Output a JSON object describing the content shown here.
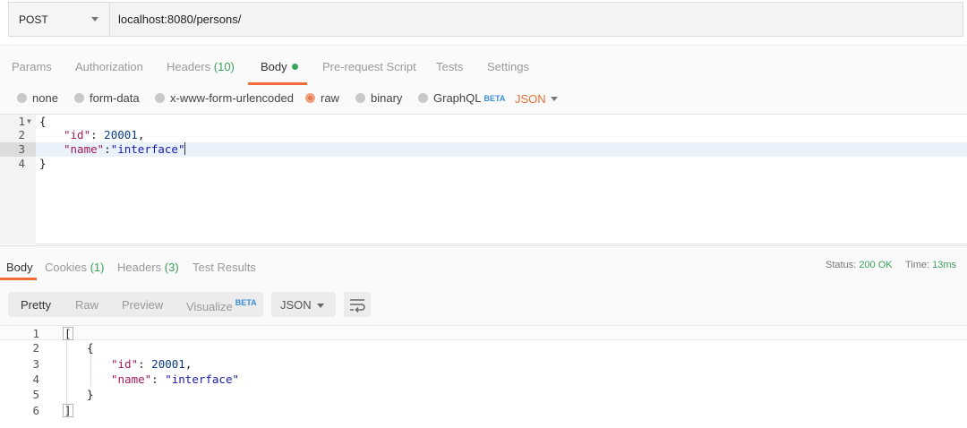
{
  "request": {
    "method": "POST",
    "url": "localhost:8080/persons/"
  },
  "request_tabs": {
    "params": "Params",
    "authorization": "Authorization",
    "headers": "Headers",
    "headers_count": "(10)",
    "body": "Body",
    "prerequest": "Pre-request Script",
    "tests": "Tests",
    "settings": "Settings"
  },
  "body_types": {
    "none": "none",
    "form_data": "form-data",
    "urlencoded": "x-www-form-urlencoded",
    "raw": "raw",
    "binary": "binary",
    "graphql": "GraphQL",
    "graphql_badge": "BETA",
    "selected": "raw",
    "format": "JSON"
  },
  "request_body": {
    "line_numbers": [
      "1",
      "2",
      "3",
      "4"
    ],
    "open_brace": "{",
    "id_key": "\"id\"",
    "id_value": "20001",
    "name_key": "\"name\"",
    "name_value": "\"interface\"",
    "close_brace": "}"
  },
  "response_tabs": {
    "body": "Body",
    "cookies": "Cookies",
    "cookies_count": "(1)",
    "headers": "Headers",
    "headers_count": "(3)",
    "test_results": "Test Results"
  },
  "response_status": {
    "status_label": "Status:",
    "status_value": "200 OK",
    "time_label": "Time:",
    "time_value": "13ms"
  },
  "response_view": {
    "pretty": "Pretty",
    "raw": "Raw",
    "preview": "Preview",
    "visualize": "Visualize",
    "visualize_badge": "BETA",
    "format": "JSON"
  },
  "response_body": {
    "line_numbers": [
      "1",
      "2",
      "3",
      "4",
      "5",
      "6"
    ],
    "open_bracket": "[",
    "open_brace": "{",
    "id_key": "\"id\"",
    "id_value": "20001",
    "name_key": "\"name\"",
    "name_value": "\"interface\"",
    "close_brace": "}",
    "close_bracket": "]"
  },
  "colors": {
    "accent": "#f26b3a",
    "status_green": "#3ca05c",
    "beta_blue": "#3a8ed8"
  }
}
